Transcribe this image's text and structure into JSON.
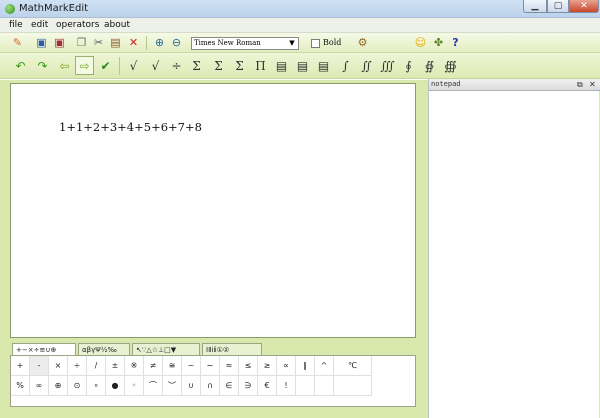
{
  "window": {
    "title": "MathMarkEdit"
  },
  "menu": [
    "file",
    "edit",
    "operators",
    "about"
  ],
  "font": {
    "selected": "Times New Roman",
    "bold_label": "Bold",
    "bold_checked": false
  },
  "toolbar1_icons": [
    "pencil-icon",
    "save-icon",
    "save-as-icon",
    "copy-icon",
    "cut-icon",
    "paste-icon",
    "delete-icon",
    "zoom-in-icon",
    "zoom-out-icon",
    "settings-icon",
    "smiley-icon",
    "puzzle-icon",
    "help-icon"
  ],
  "toolbar2": {
    "nav_icons": [
      "undo-icon",
      "redo-icon",
      "arrow-left-icon",
      "arrow-right-icon",
      "check-icon"
    ],
    "symbols": [
      "√",
      "√",
      "÷",
      "Σ",
      "Σ",
      "Σ",
      "Π",
      "▤",
      "▤",
      "▤",
      "∫",
      "∬",
      "∭",
      "∮",
      "∯",
      "∰"
    ]
  },
  "editor": {
    "formula": "1+1+2+3+4+5+6+7+8"
  },
  "notepad": {
    "title": "notepad",
    "content": ""
  },
  "palette": {
    "tabs": [
      "+−×÷≌∪⊕",
      "αβγΨ½‰",
      "↖∵△☆⊥□▼",
      "ⅠⅡⅰⅱ①②"
    ],
    "row1": [
      "+",
      "-",
      "×",
      "÷",
      "/",
      "±",
      "※",
      "≠",
      "≅",
      "~",
      "∼",
      "≈",
      "≤",
      "≥",
      "∝",
      "∥",
      "^",
      "℃"
    ],
    "row2": [
      "%",
      "∞",
      "⊕",
      "⊙",
      "∘",
      "●",
      "◦",
      "⌒",
      "︶",
      "∪",
      "∩",
      "∈",
      "∋",
      "€",
      "!"
    ]
  },
  "colors": {
    "toolbar_bg": "#e3edbf",
    "main_bg": "#d9e8ad",
    "title_bg": "#cfe1f3",
    "close_button": "#c8462b"
  }
}
